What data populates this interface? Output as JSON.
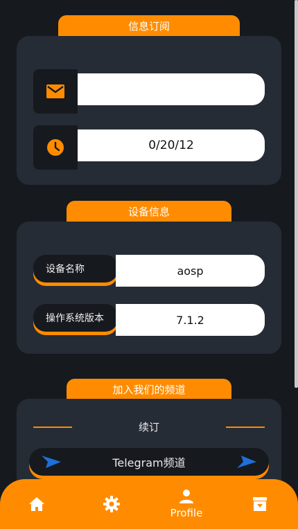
{
  "subscription": {
    "title": "信息订阅",
    "email_value": "",
    "date_value": "0/20/12"
  },
  "device": {
    "title": "设备信息",
    "rows": [
      {
        "label": "设备名称",
        "value": "aosp"
      },
      {
        "label": "操作系统版本",
        "value": "7.1.2"
      }
    ]
  },
  "channel": {
    "title": "加入我们的频道",
    "renew_label": "续订",
    "telegram_label": "Telegram频道"
  },
  "bottom_nav": {
    "items": [
      {
        "icon": "home-icon",
        "label": ""
      },
      {
        "icon": "gear-icon",
        "label": ""
      },
      {
        "icon": "person-icon",
        "label": "Profile"
      },
      {
        "icon": "archive-icon",
        "label": ""
      }
    ]
  },
  "colors": {
    "accent": "#ff8c00",
    "background": "#16191e",
    "card": "#262c36",
    "telegram": "#1e6fd9"
  }
}
